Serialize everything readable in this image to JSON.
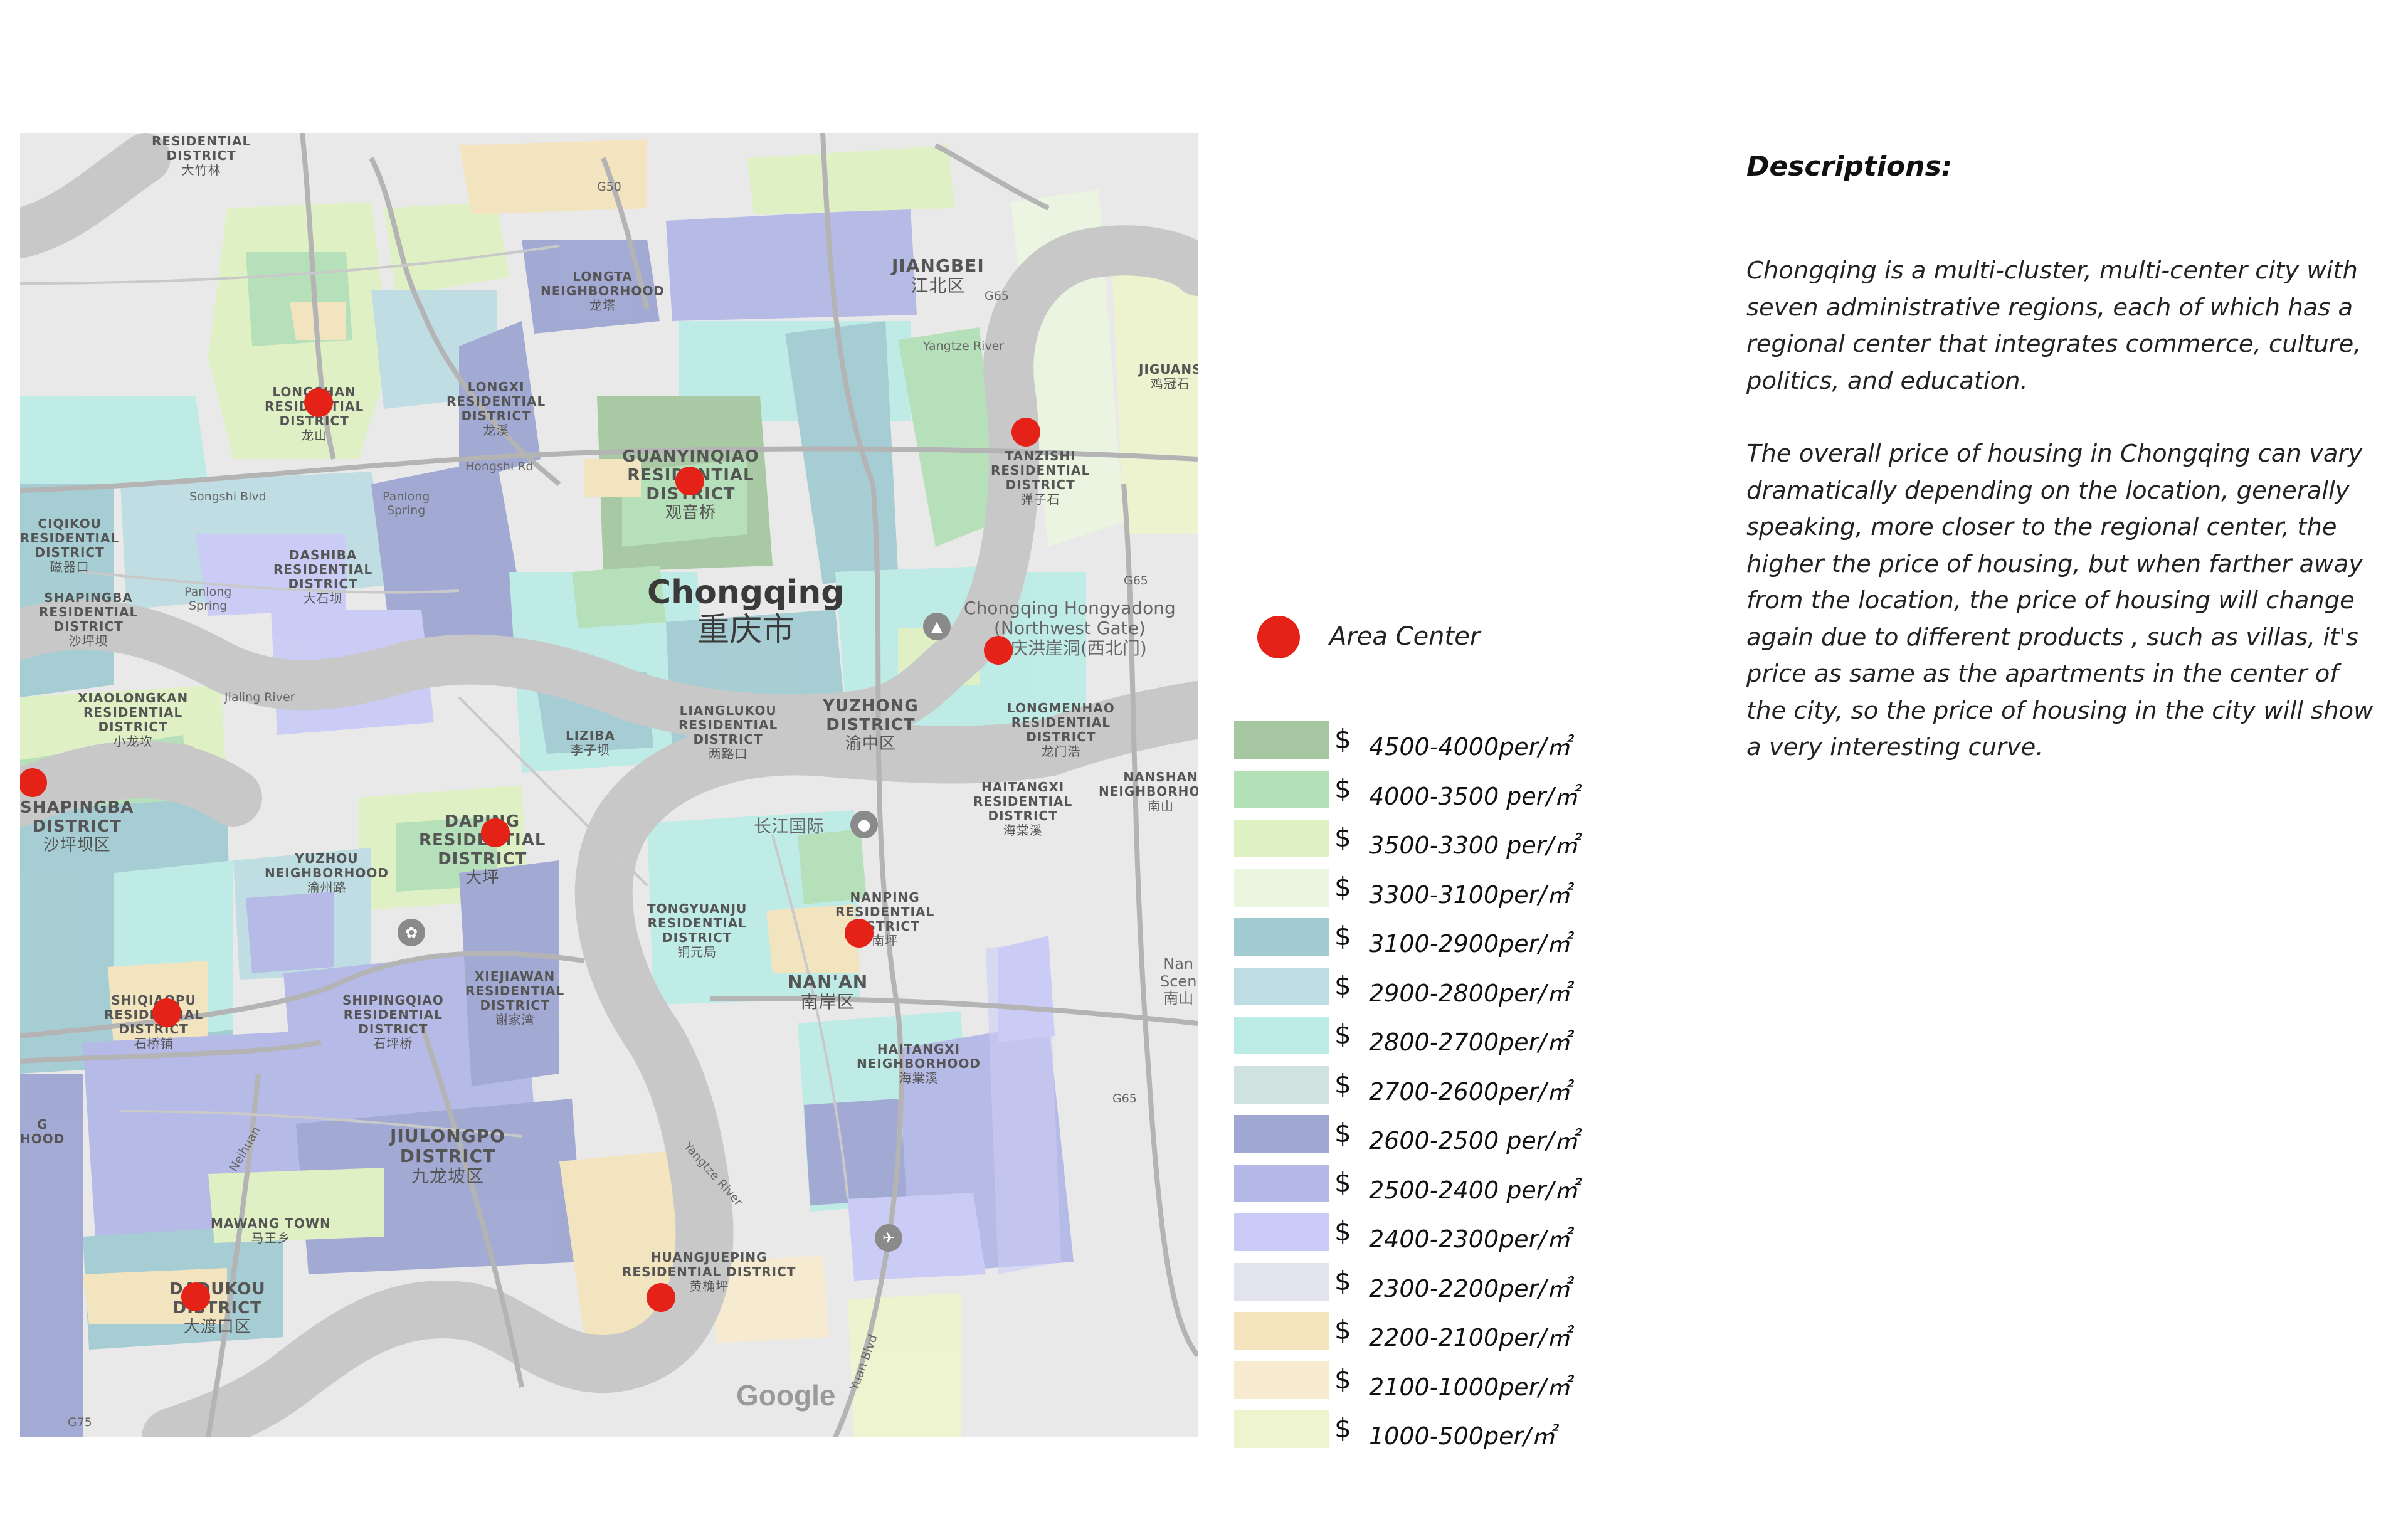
{
  "map": {
    "labels": {
      "residential_district_top": "RESIDENTIAL\nDISTRICT",
      "dazhulin": "大竹林",
      "g50": "G50",
      "longta_neighborhood": "LONGTA\nNEIGHBORHOOD",
      "longta_cn": "龙塔",
      "jiangbei": "JIANGBEI",
      "jiangbei_cn": "江北区",
      "g65_a": "G65",
      "yangtze_river_top": "Yangtze River",
      "jiguanshi": "JIGUANS",
      "jiguanshi_cn": "鸡冠石",
      "longshan": "LONGSHAN\nRESIDENTIAL\nDISTRICT",
      "longshan_cn": "龙山",
      "longxi": "LONGXI\nRESIDENTIAL\nDISTRICT",
      "longxi_cn": "龙溪",
      "hongshi_rd": "Hongshi Rd",
      "guanyinqiao": "GUANYINQIAO\nRESIDENTIAL\nDISTRICT",
      "guanyinqiao_cn": "观音桥",
      "tanzishi": "TANZISHI\nRESIDENTIAL\nDISTRICT",
      "tanzishi_cn": "弹子石",
      "songshi_blvd": "Songshi Blvd",
      "panlong_spring_a": "Panlong\nSpring",
      "ciqikou": "CIQIKOU\nRESIDENTIAL\nDISTRICT",
      "ciqikou_cn": "磁器口",
      "dashiba": "DASHIBA\nRESIDENTIAL\nDISTRICT",
      "dashiba_cn": "大石坝",
      "g65_b": "G65",
      "chongqing": "Chongqing",
      "chongqing_cn": "重庆市",
      "hongyadong": "Chongqing Hongyadong\n(Northwest Gate)",
      "hongyadong_cn": "重庆洪崖洞(西北门)",
      "shapingba_res": "SHAPINGBA\nRESIDENTIAL\nDISTRICT",
      "shapingba_res_cn": "沙坪坝",
      "panlong_spring_b": "Panlong\nSpring",
      "xiaolongkan": "XIAOLONGKAN\nRESIDENTIAL\nDISTRICT",
      "xiaolongkan_cn": "小龙坎",
      "jialing_river": "Jialing River",
      "liziba": "LIZIBA",
      "liziba_cn": "李子坝",
      "lianglukou": "LIANGLUKOU\nRESIDENTIAL\nDISTRICT",
      "lianglukou_cn": "两路口",
      "yuzhong": "YUZHONG\nDISTRICT",
      "yuzhong_cn": "渝中区",
      "longmenhao": "LONGMENHAO\nRESIDENTIAL\nDISTRICT",
      "longmenhao_cn": "龙门浩",
      "nanshan": "NANSHAN\nNEIGHBORHOOD",
      "nanshan_cn": "南山",
      "haitangxi_res": "HAITANGXI\nRESIDENTIAL\nDISTRICT",
      "haitangxi_res_cn": "海棠溪",
      "shapingba_dist": "SHAPINGBA\nDISTRICT",
      "shapingba_dist_cn": "沙坪坝区",
      "daping": "DAPING\nRESIDENTIAL\nDISTRICT",
      "daping_cn": "大坪",
      "changjiang_guoji": "长江国际",
      "yuzhou": "YUZHOU\nNEIGHBORHOOD",
      "yuzhou_cn": "渝州路",
      "tongyuanju": "TONGYUANJU\nRESIDENTIAL\nDISTRICT",
      "tongyuanju_cn": "铜元局",
      "nanping": "NANPING\nRESIDENTIAL\nDISTRICT",
      "nanping_cn": "南坪",
      "nanan": "NAN'AN",
      "nanan_cn": "南岸区",
      "nanshan_scenic": "Nan\nScen",
      "nanshan_scenic_cn": "南山",
      "shiqiaopu": "SHIQIAOPU\nRESIDENTIAL\nDISTRICT",
      "shiqiaopu_cn": "石桥铺",
      "shipingqiao": "SHIPINGQIAO\nRESIDENTIAL\nDISTRICT",
      "shipingqiao_cn": "石坪桥",
      "xiejiawan": "XIEJIAWAN\nRESIDENTIAL\nDISTRICT",
      "xiejiawan_cn": "谢家湾",
      "haitangxi_nb": "HAITANGXI\nNEIGHBORHOOD",
      "haitangxi_nb_cn": "海棠溪",
      "g65_c": "G65",
      "hood": "G\nHOOD",
      "jiulongpo": "JIULONGPO\nDISTRICT",
      "jiulongpo_cn": "九龙坡区",
      "yangtze_river_mid": "Yangtze River",
      "mawang": "MAWANG TOWN",
      "mawang_cn": "马王乡",
      "huangjueping": "HUANGJUEPING\nRESIDENTIAL DISTRICT",
      "huangjueping_cn": "黄桷坪",
      "dadukou": "DADUKOU\nDISTRICT",
      "dadukou_cn": "大渡口区",
      "g75": "G75",
      "google": "Google",
      "neihuan": "Neihuan",
      "huanxian": "Yuan Blvd",
      "yangtze_river_low": "Yangtze River"
    }
  },
  "legend": {
    "area_center": "Area Center",
    "currency_symbol": "$",
    "items": [
      {
        "label": "4500-4000per/㎡",
        "color": "#a6c7a1"
      },
      {
        "label": "4000-3500 per/㎡",
        "color": "#b4e0b7"
      },
      {
        "label": "3500-3300 per/㎡",
        "color": "#dff2c3"
      },
      {
        "label": "3300-3100per/㎡",
        "color": "#ecf5e0"
      },
      {
        "label": "3100-2900per/㎡",
        "color": "#a3ccd2"
      },
      {
        "label": "2900-2800per/㎡",
        "color": "#bddde2"
      },
      {
        "label": "2800-2700per/㎡",
        "color": "#bdece6"
      },
      {
        "label": "2700-2600per/㎡",
        "color": "#d1e3e0"
      },
      {
        "label": "2600-2500 per/㎡",
        "color": "#9fa7d2"
      },
      {
        "label": "2500-2400 per/㎡",
        "color": "#b3b8e6"
      },
      {
        "label": "2400-2300per/㎡",
        "color": "#c9cbf6"
      },
      {
        "label": "2300-2200per/㎡",
        "color": "#e2e3ec"
      },
      {
        "label": "2200-2100per/㎡",
        "color": "#f4e4be"
      },
      {
        "label": "2100-1000per/㎡",
        "color": "#f7ebd0"
      },
      {
        "label": "1000-500per/㎡",
        "color": "#eef4ce"
      }
    ]
  },
  "description": {
    "heading": "Descriptions:",
    "paragraph_1": "Chongqing is a multi-cluster, multi-center city with seven administrative regions, each of which has a regional center that integrates commerce, culture, politics, and education.",
    "paragraph_2": "The overall price of housing in Chongqing can vary dramatically depending on the location, generally speaking, more closer to the regional center, the higher the price of housing, but when farther away from the location, the price of housing will change again due to different products , such as villas, it's price as same as the apartments in the center of the city, so the price of housing in the city will show a very interesting curve."
  }
}
